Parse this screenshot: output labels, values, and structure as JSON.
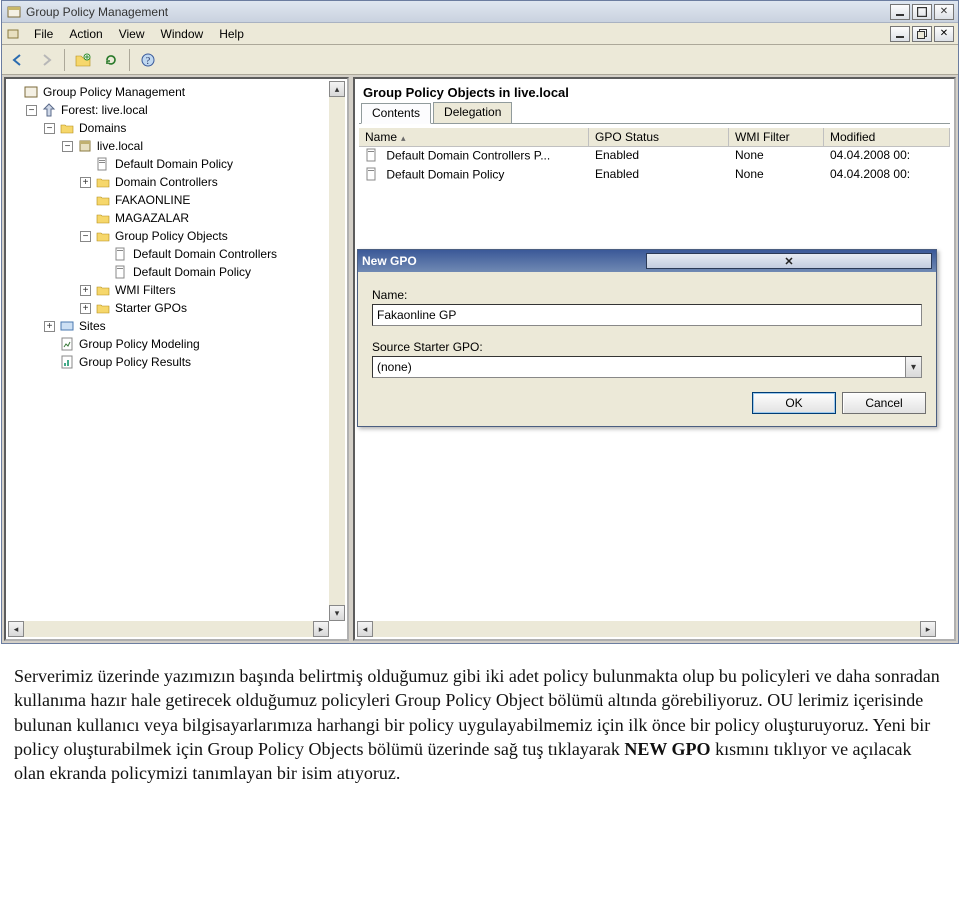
{
  "window": {
    "title": "Group Policy Management"
  },
  "menubar": {
    "file": "File",
    "action": "Action",
    "view": "View",
    "window": "Window",
    "help": "Help"
  },
  "tree": {
    "root": "Group Policy Management",
    "forest": "Forest: live.local",
    "domains": "Domains",
    "live": "live.local",
    "ddp": "Default Domain Policy",
    "dc": "Domain Controllers",
    "fakaonline": "FAKAONLINE",
    "magazalar": "MAGAZALAR",
    "gpo": "Group Policy Objects",
    "gpo_ddc": "Default Domain Controllers",
    "gpo_ddp": "Default Domain Policy",
    "wmi": "WMI Filters",
    "starter": "Starter GPOs",
    "sites": "Sites",
    "modeling": "Group Policy Modeling",
    "results": "Group Policy Results"
  },
  "right": {
    "title": "Group Policy Objects in live.local",
    "tab_contents": "Contents",
    "tab_delegation": "Delegation",
    "col_name": "Name",
    "col_status": "GPO Status",
    "col_wmi": "WMI Filter",
    "col_mod": "Modified",
    "rows": [
      {
        "name": "Default Domain Controllers P...",
        "status": "Enabled",
        "wmi": "None",
        "mod": "04.04.2008 00:"
      },
      {
        "name": "Default Domain Policy",
        "status": "Enabled",
        "wmi": "None",
        "mod": "04.04.2008 00:"
      }
    ]
  },
  "dialog": {
    "title": "New GPO",
    "name_label": "Name:",
    "name_value": "Fakaonline GP",
    "src_label": "Source Starter GPO:",
    "src_value": "(none)",
    "ok": "OK",
    "cancel": "Cancel"
  },
  "article": {
    "p": "Serverimiz üzerinde yazımızın başında belirtmiş olduğumuz gibi iki adet policy bulunmakta olup bu policyleri ve daha sonradan kullanıma hazır hale getirecek olduğumuz policyleri Group Policy Object bölümü altında görebiliyoruz. OU lerimiz içerisinde bulunan kullanıcı veya bilgisayarlarımıza harhangi bir policy uygulayabilmemiz için ilk önce bir policy oluşturuyoruz. Yeni bir policy oluşturabilmek için Group Policy Objects bölümü üzerinde sağ tuş tıklayarak ",
    "bold": "NEW GPO",
    "rest": " kısmını tıklıyor ve açılacak olan ekranda policymizi tanımlayan bir isim atıyoruz."
  }
}
